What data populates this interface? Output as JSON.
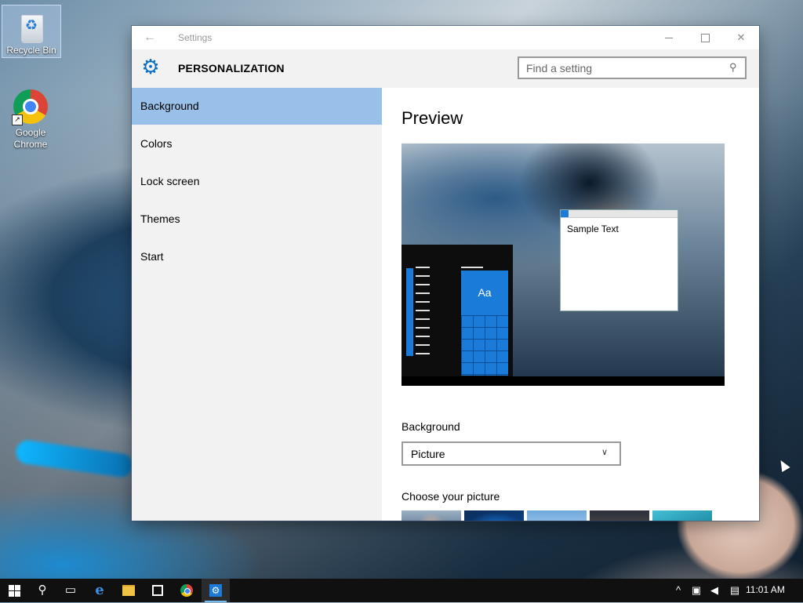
{
  "desktop": {
    "icons": [
      {
        "label": "Recycle Bin"
      },
      {
        "label": "Google Chrome"
      }
    ]
  },
  "window": {
    "title": "Settings",
    "header": {
      "app_title": "PERSONALIZATION",
      "search_placeholder": "Find a setting"
    },
    "sidebar": {
      "items": [
        {
          "label": "Background",
          "selected": true
        },
        {
          "label": "Colors"
        },
        {
          "label": "Lock screen"
        },
        {
          "label": "Themes"
        },
        {
          "label": "Start"
        }
      ]
    },
    "content": {
      "preview_title": "Preview",
      "preview_tile_text": "Aa",
      "preview_sample_text": "Sample Text",
      "background_label": "Background",
      "background_value": "Picture",
      "choose_label": "Choose your picture"
    }
  },
  "taskbar": {
    "clock": "11:01 AM"
  },
  "colors": {
    "accent": "#1a7cd8",
    "selected_nav": "#98c0e9",
    "taskbar": "#101010"
  },
  "icons": [
    "back-arrow-icon",
    "settings-gear-icon",
    "search-icon",
    "chevron-down-icon",
    "windows-icon",
    "search-taskbar-icon",
    "task-view-icon",
    "edge-icon",
    "file-explorer-icon",
    "store-icon",
    "chrome-icon",
    "settings-taskbar-icon",
    "show-hidden-icons-icon",
    "network-icon",
    "volume-muted-icon",
    "action-center-icon"
  ]
}
